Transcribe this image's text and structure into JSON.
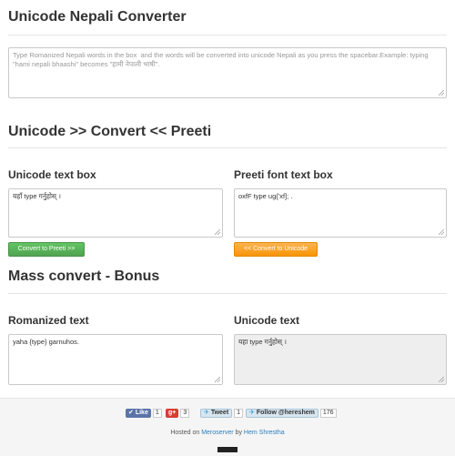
{
  "header": {
    "title": "Unicode Nepali Converter"
  },
  "main_input": {
    "placeholder": "Type Romanized Nepali words in the box  and the words will be converted into unicode Nepali as you press the spacebar.Example: typing \"hami nepali bhaashi\" becomes \"हामी नेपाली भाषी\"."
  },
  "convert_section": {
    "title": "Unicode >> Convert << Preeti",
    "unicode_label": "Unicode text box",
    "unicode_value": "यहाँ type गर्नुहोस् ।",
    "preeti_label": "Preeti font text box",
    "preeti_value": "oxfF type ug{'xf]; .",
    "to_preeti_button": "Convert to Preeti >>",
    "to_unicode_button": "<< Convert to Unicode"
  },
  "mass_section": {
    "title": "Mass convert - Bonus",
    "romanized_label": "Romanized text",
    "romanized_value": "yaha {type} garnuhos.",
    "unicode_label": "Unicode text",
    "unicode_value": "यहा type गर्नुहोस् ।"
  },
  "footer": {
    "like_label": "Like",
    "like_count": "1",
    "gplus_label": "g+",
    "gplus_count": "3",
    "tweet_label": "Tweet",
    "tweet_count": "1",
    "follow_label": "Follow @hereshem",
    "follow_count": "176",
    "hosted_prefix": "Hosted on",
    "host_link": "Meroserver",
    "by_text": "by",
    "author_link": "Hem Shrestha"
  },
  "colors": {
    "green_button": "#5bb75b",
    "orange_button": "#faa732",
    "link": "#2a7fbf"
  }
}
